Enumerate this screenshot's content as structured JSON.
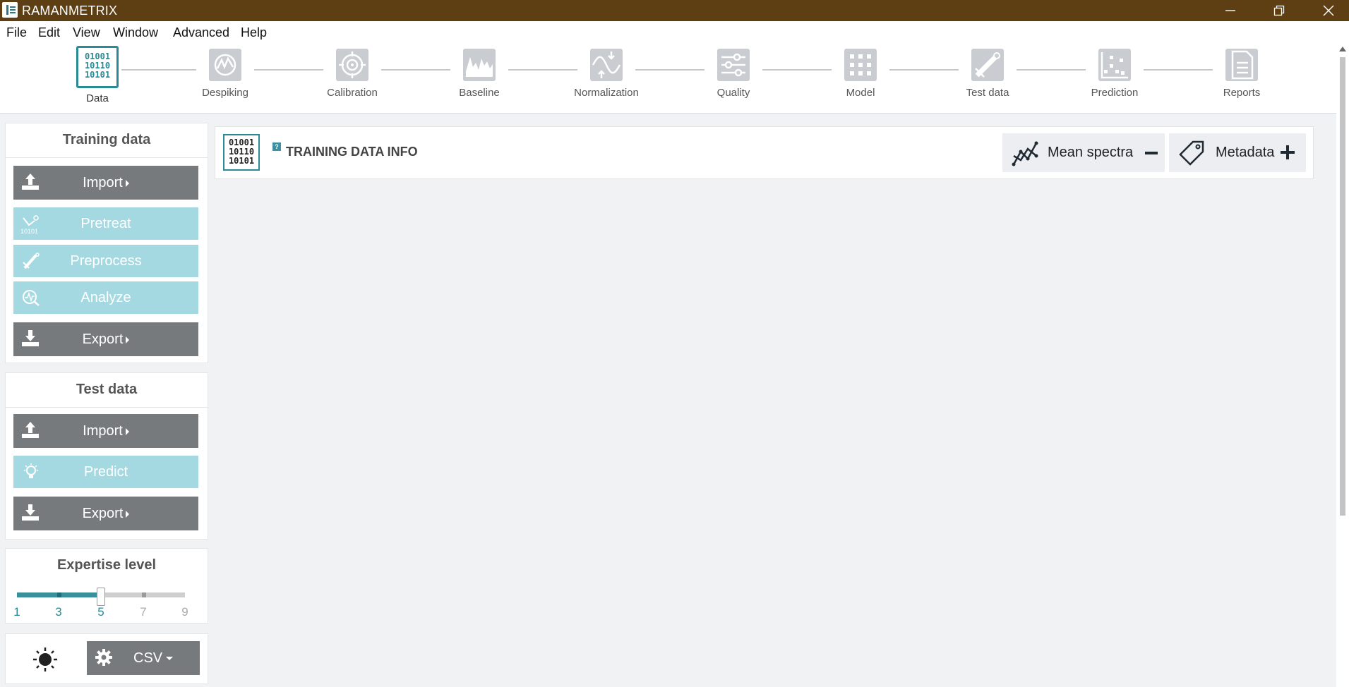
{
  "window": {
    "title": "RAMANMETRIX"
  },
  "menu": {
    "items": [
      "File",
      "Edit",
      "View",
      "Window",
      "Advanced",
      "Help"
    ]
  },
  "workflow": {
    "steps": [
      {
        "label": "Data",
        "icon": "binary-data-icon",
        "active": true,
        "bits": [
          "01001",
          "10110",
          "10101"
        ]
      },
      {
        "label": "Despiking",
        "icon": "despiking-icon"
      },
      {
        "label": "Calibration",
        "icon": "target-icon"
      },
      {
        "label": "Baseline",
        "icon": "spectrum-icon"
      },
      {
        "label": "Normalization",
        "icon": "wave-arrows-icon"
      },
      {
        "label": "Quality",
        "icon": "sliders-icon"
      },
      {
        "label": "Model",
        "icon": "grid-dots-icon"
      },
      {
        "label": "Test data",
        "icon": "satellite-icon"
      },
      {
        "label": "Prediction",
        "icon": "scatter-icon"
      },
      {
        "label": "Reports",
        "icon": "document-icon"
      }
    ]
  },
  "sidebar": {
    "training": {
      "title": "Training data",
      "import_label": "Import",
      "pretreat_label": "Pretreat",
      "pretreat_icon_text": "10101",
      "preprocess_label": "Preprocess",
      "analyze_label": "Analyze",
      "export_label": "Export"
    },
    "test": {
      "title": "Test data",
      "import_label": "Import",
      "predict_label": "Predict",
      "export_label": "Export"
    },
    "expertise": {
      "title": "Expertise level",
      "levels": [
        "1",
        "3",
        "5",
        "7",
        "9"
      ],
      "value": 5,
      "min": 1,
      "max": 9,
      "accent": "#3a8f9c"
    },
    "bottom": {
      "format_label": "CSV"
    }
  },
  "main": {
    "info_title": "TRAINING DATA INFO",
    "info_bits": [
      "01001",
      "10110",
      "10101"
    ],
    "help_mark": "?",
    "mean_spectra_label": "Mean spectra",
    "metadata_label": "Metadata"
  },
  "colors": {
    "titlebar": "#5e3f14",
    "dark_button": "#777a7c",
    "light_button": "#a5d9e2",
    "accent": "#2a8a96"
  }
}
